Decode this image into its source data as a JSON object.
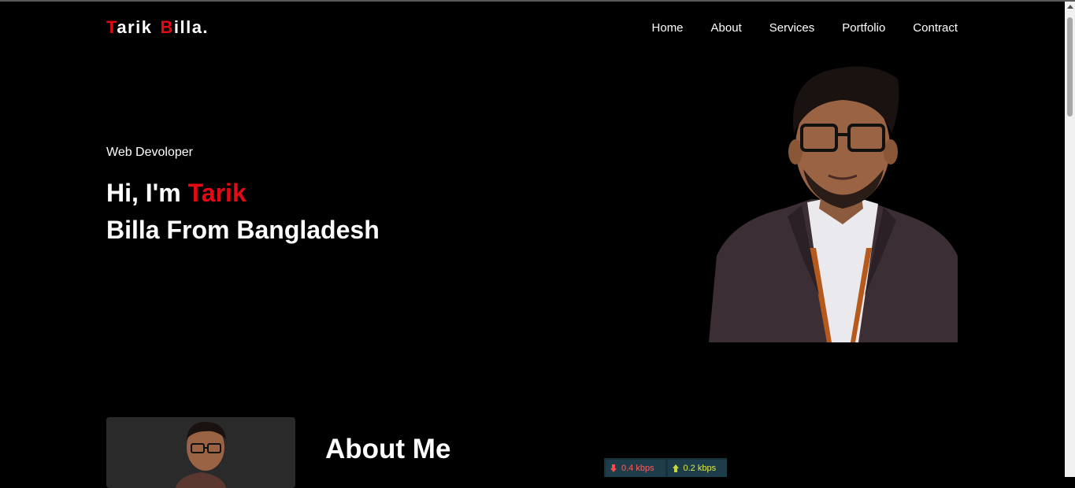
{
  "logo": {
    "t": "T",
    "arik": "arik",
    "b": "B",
    "illa": "illa."
  },
  "nav": {
    "home": "Home",
    "about": "About",
    "services": "Services",
    "portfolio": "Portfolio",
    "contract": "Contract"
  },
  "hero": {
    "subtitle": "Web Devoloper",
    "greeting": "Hi, I'm ",
    "name_highlight": "Tarik",
    "line2": "Billa From Bangladesh"
  },
  "about": {
    "title": "About Me"
  },
  "netmeter": {
    "download": "0.4 kbps",
    "upload": "0.2 kbps"
  },
  "colors": {
    "accent": "#e50914",
    "background": "#000000",
    "text": "#ffffff"
  }
}
